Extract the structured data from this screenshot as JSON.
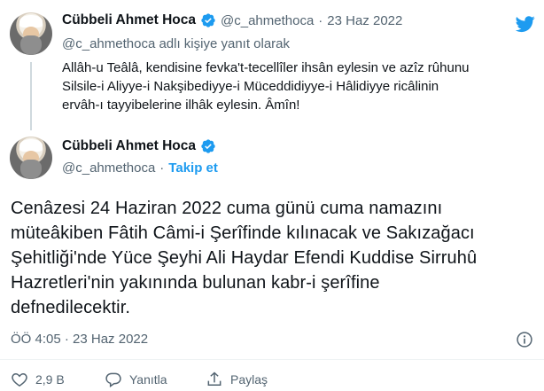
{
  "tweet1": {
    "author_name": "Cübbeli Ahmet Hoca",
    "handle": "@c_ahmethoca",
    "separator": "·",
    "date": "23 Haz 2022",
    "reply_context": "@c_ahmethoca adlı kişiye yanıt olarak",
    "lines": [
      "Allâh-u Teâlâ, kendisine fevka't-tecellîler ihsân eylesin ve azîz rûhunu",
      "Silsile-i Aliyye-i Nakşibediyye-i Müceddidiyye-i Hâlidiyye ricâlinin",
      "ervâh-ı tayyibelerine ilhâk eylesin. Âmîn!"
    ]
  },
  "tweet2": {
    "author_name": "Cübbeli Ahmet Hoca",
    "handle": "@c_ahmethoca",
    "separator": "·",
    "follow_label": "Takip et",
    "lines": [
      "Cenâzesi 24 Haziran 2022 cuma günü cuma namazını",
      "müteâkiben Fâtih Câmi-i Şerîfinde kılınacak ve Sakızağacı",
      "Şehitliği'nde Yüce Şeyhi Ali Haydar Efendi Kuddise Sirruhû",
      "Hazretleri'nin yakınında bulunan kabr-i şerîfine",
      "defnedilecektir."
    ],
    "timestamp": "ÖÖ 4:05 · 23 Haz 2022"
  },
  "actions": {
    "like_count": "2,9 B",
    "reply_label": "Yanıtla",
    "share_label": "Paylaş"
  },
  "colors": {
    "twitter_blue": "#1d9bf0",
    "text": "#0f1419",
    "secondary": "#536471"
  },
  "icons": [
    "twitter-logo-icon",
    "verified-badge-icon",
    "info-icon",
    "heart-icon",
    "reply-icon",
    "share-icon"
  ]
}
